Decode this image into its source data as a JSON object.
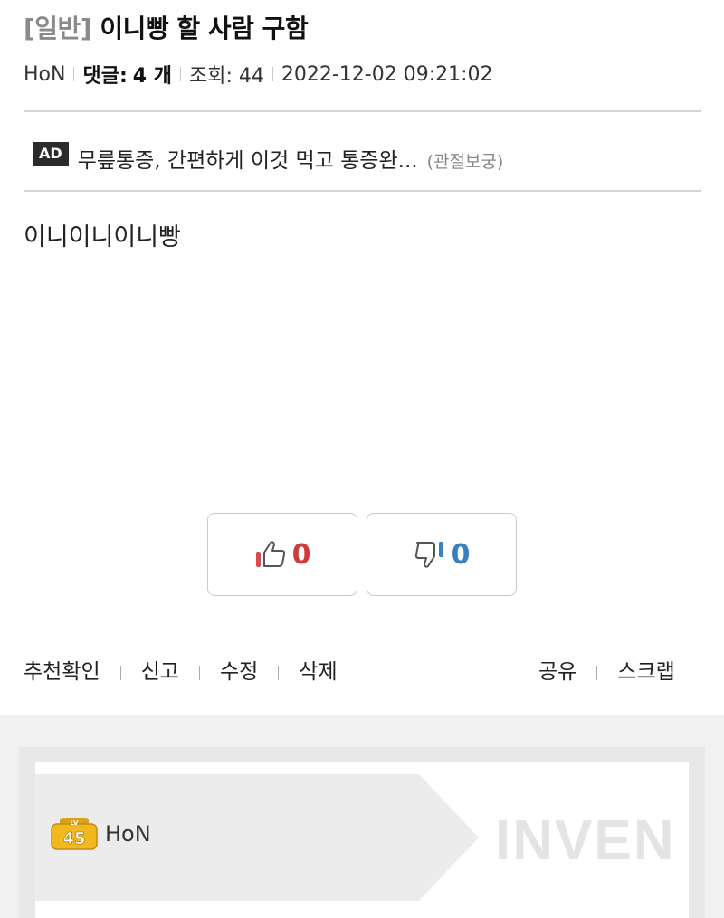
{
  "post": {
    "category": "[일반]",
    "title": "이니빵 할 사람 구함",
    "author": "HoN",
    "comments_label": "댓글:",
    "comments_value": "4 개",
    "views_label": "조회: 44",
    "date": "2022-12-02 09:21:02",
    "body": "이니이니이니빵"
  },
  "ad": {
    "badge": "AD",
    "text": "무릎통증, 간편하게 이것 먹고 통증완...",
    "source": "(관절보궁)"
  },
  "votes": {
    "up": "0",
    "down": "0"
  },
  "actions": {
    "left": [
      "추천확인",
      "신고",
      "수정",
      "삭제"
    ],
    "right": [
      "공유",
      "스크랩"
    ]
  },
  "profile": {
    "level": "45",
    "level_prefix": "LV",
    "name": "HoN",
    "watermark": "INVEN"
  }
}
